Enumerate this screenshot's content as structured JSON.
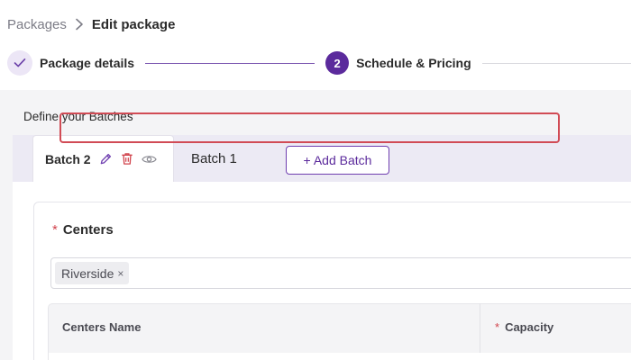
{
  "breadcrumb": {
    "parent": "Packages",
    "separator_icon": "chevron-right-icon",
    "current": "Edit package"
  },
  "stepper": {
    "steps": [
      {
        "label": "Package details",
        "state": "completed",
        "icon": "check-icon"
      },
      {
        "label": "Schedule & Pricing",
        "state": "active",
        "number": "2"
      }
    ],
    "accent_color": "#5b2a9c"
  },
  "batches": {
    "section_title": "Define your Batches",
    "tabs": [
      {
        "label": "Batch 2",
        "active": true,
        "icons": [
          "edit-icon",
          "delete-icon",
          "eye-icon"
        ]
      },
      {
        "label": "Batch 1",
        "active": false
      }
    ],
    "add_button_label": "+ Add Batch"
  },
  "centers": {
    "label": "Centers",
    "required_mark": "*",
    "selected": [
      {
        "label": "Riverside",
        "remove_symbol": "×"
      }
    ]
  },
  "table": {
    "columns": [
      {
        "label": "Centers Name",
        "required": false
      },
      {
        "label": "Capacity",
        "required": true,
        "required_mark": "*"
      }
    ]
  },
  "colors": {
    "accent": "#5b2a9c",
    "highlight_box": "#d14b55",
    "required": "#d1434c",
    "delete_icon": "#d1434c"
  }
}
